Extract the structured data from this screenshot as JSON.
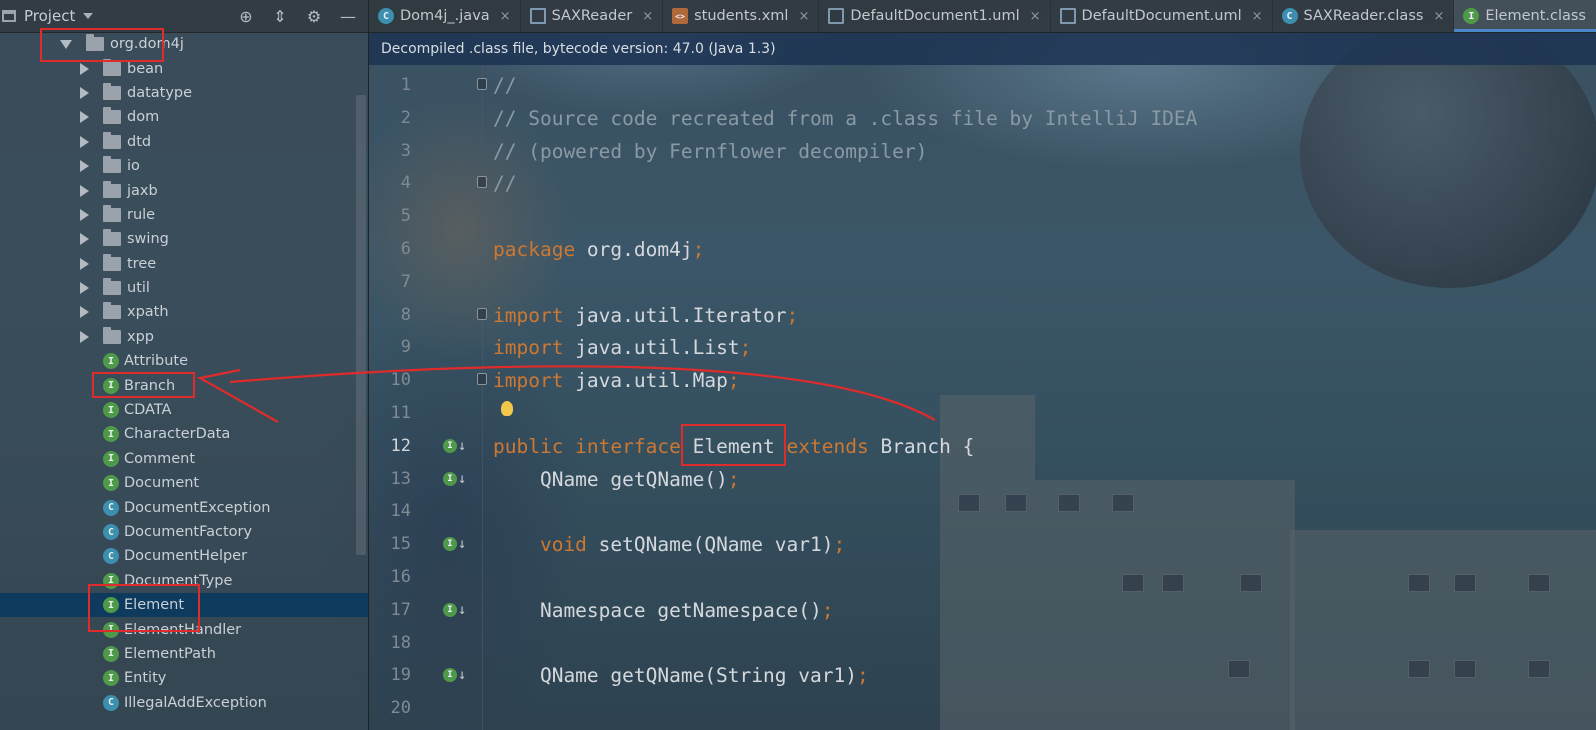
{
  "project_panel": {
    "title": "Project",
    "tools": [
      "locate-icon",
      "collapse-icon",
      "gear-icon",
      "minimize-icon"
    ],
    "tree": [
      {
        "label": "org.dom4j",
        "kind": "folder",
        "expanded": true,
        "depth": 0
      },
      {
        "label": "bean",
        "kind": "folder",
        "depth": 1
      },
      {
        "label": "datatype",
        "kind": "folder",
        "depth": 1
      },
      {
        "label": "dom",
        "kind": "folder",
        "depth": 1
      },
      {
        "label": "dtd",
        "kind": "folder",
        "depth": 1
      },
      {
        "label": "io",
        "kind": "folder",
        "depth": 1
      },
      {
        "label": "jaxb",
        "kind": "folder",
        "depth": 1
      },
      {
        "label": "rule",
        "kind": "folder",
        "depth": 1
      },
      {
        "label": "swing",
        "kind": "folder",
        "depth": 1
      },
      {
        "label": "tree",
        "kind": "folder",
        "depth": 1
      },
      {
        "label": "util",
        "kind": "folder",
        "depth": 1
      },
      {
        "label": "xpath",
        "kind": "folder",
        "depth": 1
      },
      {
        "label": "xpp",
        "kind": "folder",
        "depth": 1
      },
      {
        "label": "Attribute",
        "kind": "interface",
        "depth": 1
      },
      {
        "label": "Branch",
        "kind": "interface",
        "depth": 1
      },
      {
        "label": "CDATA",
        "kind": "interface",
        "depth": 1
      },
      {
        "label": "CharacterData",
        "kind": "interface",
        "depth": 1
      },
      {
        "label": "Comment",
        "kind": "interface",
        "depth": 1
      },
      {
        "label": "Document",
        "kind": "interface",
        "depth": 1
      },
      {
        "label": "DocumentException",
        "kind": "class",
        "depth": 1
      },
      {
        "label": "DocumentFactory",
        "kind": "class",
        "depth": 1
      },
      {
        "label": "DocumentHelper",
        "kind": "class",
        "depth": 1
      },
      {
        "label": "DocumentType",
        "kind": "interface",
        "depth": 1
      },
      {
        "label": "Element",
        "kind": "interface",
        "depth": 1,
        "selected": true
      },
      {
        "label": "ElementHandler",
        "kind": "interface",
        "depth": 1
      },
      {
        "label": "ElementPath",
        "kind": "interface",
        "depth": 1
      },
      {
        "label": "Entity",
        "kind": "interface",
        "depth": 1
      },
      {
        "label": "IllegalAddException",
        "kind": "class",
        "depth": 1
      }
    ]
  },
  "tabs": [
    {
      "label": "Dom4j_.java",
      "icon": "c"
    },
    {
      "label": "SAXReader",
      "icon": "uml"
    },
    {
      "label": "students.xml",
      "icon": "xml"
    },
    {
      "label": "DefaultDocument1.uml",
      "icon": "uml"
    },
    {
      "label": "DefaultDocument.uml",
      "icon": "uml"
    },
    {
      "label": "SAXReader.class",
      "icon": "c"
    },
    {
      "label": "Element.class",
      "icon": "i",
      "active": true
    }
  ],
  "tab_close": "×",
  "editor": {
    "notice": "Decompiled .class file, bytecode version: 47.0 (Java 1.3)",
    "lines": [
      {
        "n": "1",
        "segments": [
          {
            "t": "//",
            "c": "cm"
          }
        ],
        "fold": true
      },
      {
        "n": "2",
        "segments": [
          {
            "t": "// Source code recreated from a .class file by IntelliJ IDEA",
            "c": "cm"
          }
        ]
      },
      {
        "n": "3",
        "segments": [
          {
            "t": "// (powered by Fernflower decompiler)",
            "c": "cm"
          }
        ]
      },
      {
        "n": "4",
        "segments": [
          {
            "t": "//",
            "c": "cm"
          }
        ],
        "fold": true
      },
      {
        "n": "5",
        "segments": []
      },
      {
        "n": "6",
        "segments": [
          {
            "t": "package ",
            "c": "k"
          },
          {
            "t": "org.dom4j",
            "c": "pl"
          },
          {
            "t": ";",
            "c": "k"
          }
        ]
      },
      {
        "n": "7",
        "segments": []
      },
      {
        "n": "8",
        "segments": [
          {
            "t": "import ",
            "c": "k"
          },
          {
            "t": "java.util.Iterator",
            "c": "pl"
          },
          {
            "t": ";",
            "c": "k"
          }
        ],
        "fold": true
      },
      {
        "n": "9",
        "segments": [
          {
            "t": "import ",
            "c": "k"
          },
          {
            "t": "java.util.List",
            "c": "pl"
          },
          {
            "t": ";",
            "c": "k"
          }
        ]
      },
      {
        "n": "10",
        "segments": [
          {
            "t": "import ",
            "c": "k"
          },
          {
            "t": "java.util.Map",
            "c": "pl"
          },
          {
            "t": ";",
            "c": "k"
          }
        ],
        "fold": true
      },
      {
        "n": "11",
        "segments": [],
        "bulb": true
      },
      {
        "n": "12",
        "segments": [
          {
            "t": "public interface ",
            "c": "k"
          },
          {
            "t": "Element ",
            "c": "pl"
          },
          {
            "t": "extends ",
            "c": "k"
          },
          {
            "t": "Branch {",
            "c": "pl"
          }
        ],
        "impl": true,
        "current": true
      },
      {
        "n": "13",
        "segments": [
          {
            "t": "    QName getQName()",
            "c": "pl"
          },
          {
            "t": ";",
            "c": "k"
          }
        ],
        "impl": true
      },
      {
        "n": "14",
        "segments": []
      },
      {
        "n": "15",
        "segments": [
          {
            "t": "    void ",
            "c": "k"
          },
          {
            "t": "setQName(QName var1)",
            "c": "pl"
          },
          {
            "t": ";",
            "c": "k"
          }
        ],
        "impl": true
      },
      {
        "n": "16",
        "segments": []
      },
      {
        "n": "17",
        "segments": [
          {
            "t": "    Namespace getNamespace()",
            "c": "pl"
          },
          {
            "t": ";",
            "c": "k"
          }
        ],
        "impl": true
      },
      {
        "n": "18",
        "segments": []
      },
      {
        "n": "19",
        "segments": [
          {
            "t": "    QName getQName(String var1)",
            "c": "pl"
          },
          {
            "t": ";",
            "c": "k"
          }
        ],
        "impl": true
      },
      {
        "n": "20",
        "segments": []
      }
    ]
  },
  "impl_marker": "I",
  "colors": {
    "keyword": "#cc7832",
    "comment": "#8a9aa5",
    "annotation_red": "#e02b2b",
    "selection": "#0e3a5e",
    "accent": "#4a88c7"
  }
}
